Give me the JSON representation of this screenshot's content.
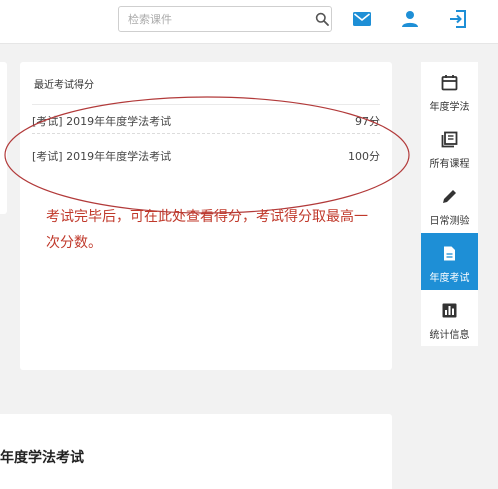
{
  "header": {
    "search_placeholder": "检索课件",
    "icons": [
      "search-icon",
      "mail-icon",
      "user-icon",
      "logout-icon"
    ],
    "icon_color": "#1e8fd6"
  },
  "recent_scores": {
    "title": "最近考试得分",
    "rows": [
      {
        "name": "[考试] 2019年年度学法考试",
        "score": "97分"
      },
      {
        "name": "[考试] 2019年年度学法考试",
        "score": "100分"
      }
    ]
  },
  "annotation": {
    "text": "考试完毕后，可在此处查看得分，考试得分取最高一次分数。",
    "color": "#c0392b"
  },
  "nav": {
    "items": [
      {
        "label": "年度学法",
        "icon": "calendar-icon",
        "active": false
      },
      {
        "label": "所有课程",
        "icon": "book-icon",
        "active": false
      },
      {
        "label": "日常测验",
        "icon": "pencil-icon",
        "active": false
      },
      {
        "label": "年度考试",
        "icon": "document-icon",
        "active": true
      },
      {
        "label": "统计信息",
        "icon": "bar-chart-icon",
        "active": false
      }
    ],
    "active_color": "#1e8fd6"
  },
  "bottom_card": {
    "title": "年度学法考试"
  }
}
